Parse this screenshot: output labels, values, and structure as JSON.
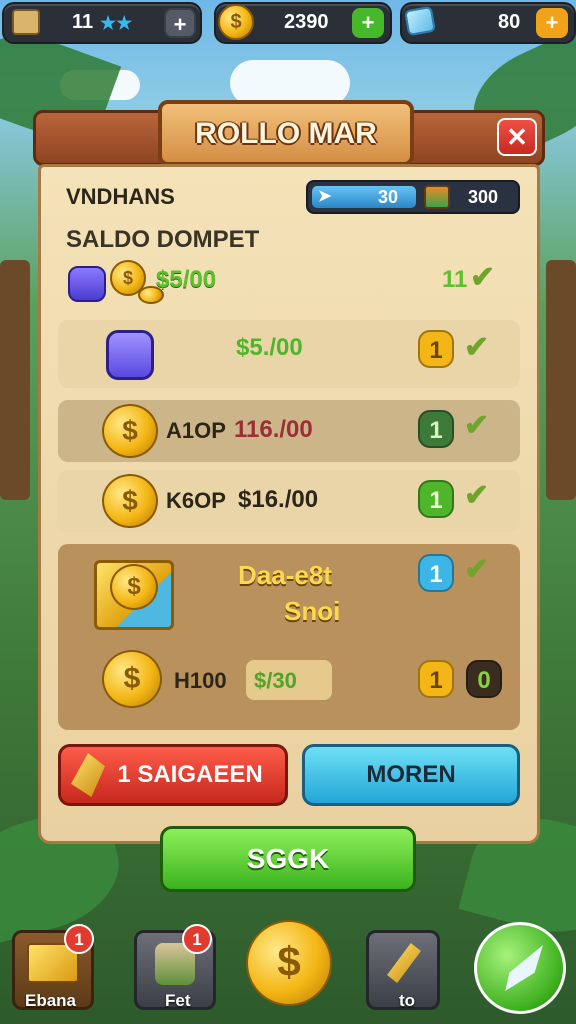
{
  "topbar": {
    "level_value": "11",
    "stars": "★★",
    "plus1": "+",
    "coins_value": "2390",
    "plus2": "+",
    "gems_value": "80",
    "plus3": "+"
  },
  "dialog": {
    "title": "ROLLO MAR",
    "close": "✕",
    "section_label": "VNDHANS",
    "resource_blue_value": "30",
    "resource_chest_value": "300",
    "wallet_label": "SALDO DOMPET"
  },
  "rows": [
    {
      "price": "$5/00",
      "count": "11"
    },
    {
      "price": "$5./00",
      "count": "1"
    },
    {
      "name": "A1OP",
      "price": "116./00",
      "count": "1"
    },
    {
      "name": "K6OP",
      "price": "$16./00",
      "count": "1"
    },
    {
      "title": "Daa-e8t",
      "subtitle": "Snoi",
      "count": "1"
    },
    {
      "name": "H100",
      "price": "$/30",
      "count": "1",
      "count2": "0"
    }
  ],
  "buttons": {
    "red": "1 SAIGAEEN",
    "blue": "MOREN",
    "green": "SGGK"
  },
  "bottom_nav": [
    {
      "label": "Ebana",
      "badge": "1"
    },
    {
      "label": "Fet",
      "badge": "1"
    },
    {
      "label": ""
    },
    {
      "label": "to"
    },
    {
      "label": ""
    }
  ],
  "colors": {
    "accent_green": "#5ccf2e",
    "accent_blue": "#3cc4ea",
    "accent_red": "#e5392c",
    "coin_gold": "#f3b614"
  }
}
